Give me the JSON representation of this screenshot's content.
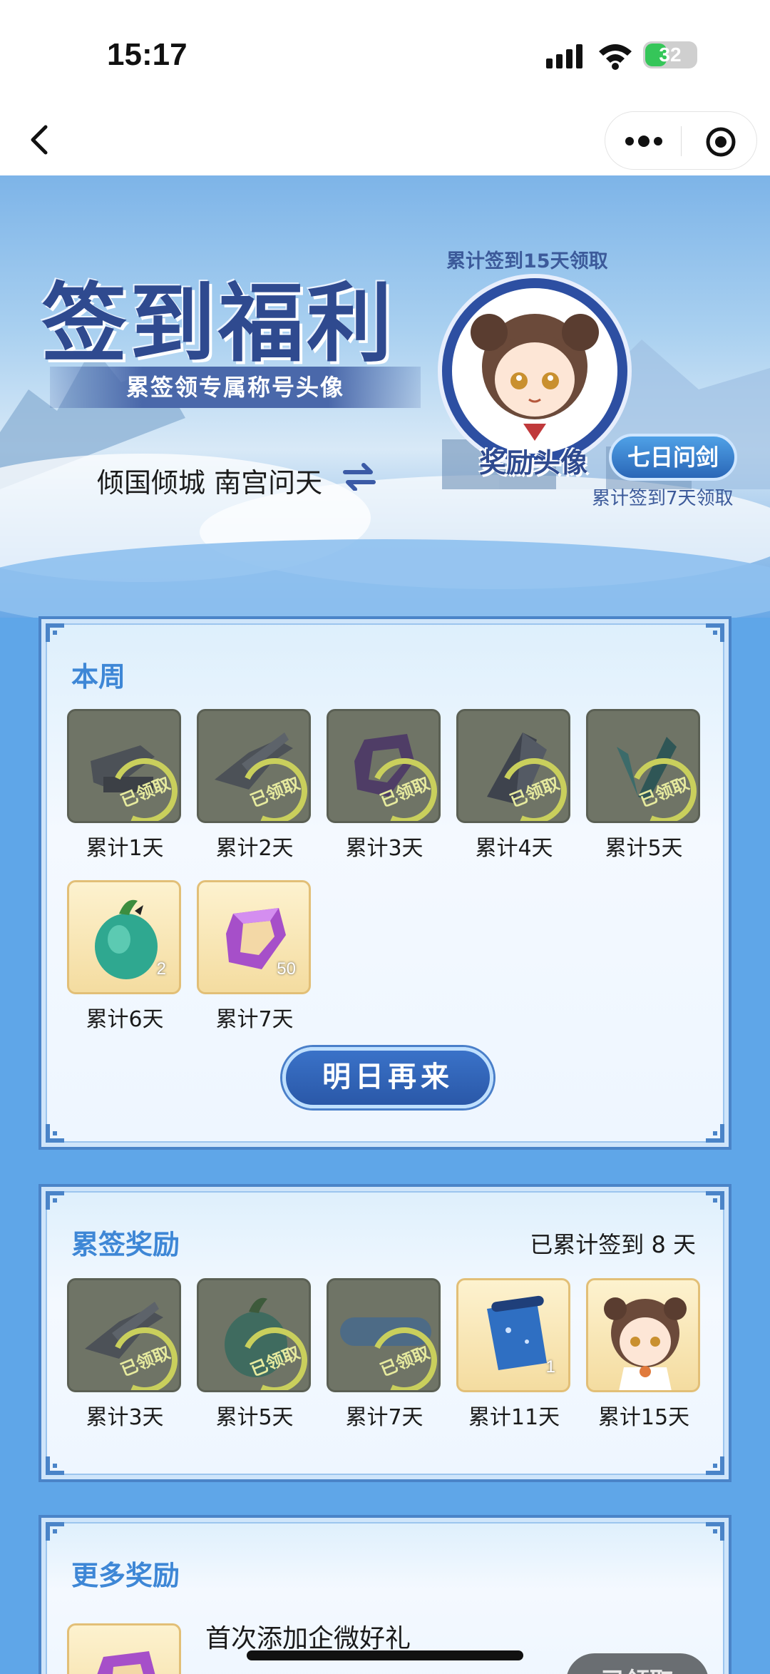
{
  "status_bar": {
    "time": "15:17",
    "battery": "32"
  },
  "banner": {
    "title": "签到福利",
    "subtitle": "累签领专属称号头像",
    "user_title": "倾国倾城 南宫问天",
    "avatar_caption": "累计签到15天领取",
    "avatar_label": "奖励头像",
    "title_badge": "七日问剑",
    "title_caption": "累计签到7天领取"
  },
  "this_week": {
    "heading": "本周",
    "items": [
      {
        "label": "累计1天",
        "claimed": true,
        "claimed_text": "已领取",
        "icon": "gray-anvil-icon"
      },
      {
        "label": "累计2天",
        "claimed": true,
        "claimed_text": "已领取",
        "icon": "gray-weapon-icon"
      },
      {
        "label": "累计3天",
        "claimed": true,
        "claimed_text": "已领取",
        "icon": "purple-gem-icon"
      },
      {
        "label": "累计4天",
        "claimed": true,
        "claimed_text": "已领取",
        "icon": "gray-crystal-icon"
      },
      {
        "label": "累计5天",
        "claimed": true,
        "claimed_text": "已领取",
        "icon": "green-leaf-icon"
      },
      {
        "label": "累计6天",
        "claimed": false,
        "qty": "2",
        "icon": "green-pouch-icon"
      },
      {
        "label": "累计7天",
        "claimed": false,
        "qty": "50",
        "icon": "purple-gem-icon"
      }
    ],
    "button": "明日再来"
  },
  "cumulative": {
    "heading": "累签奖励",
    "note": "已累计签到 8 天",
    "items": [
      {
        "label": "累计3天",
        "claimed": true,
        "claimed_text": "已领取",
        "icon": "gray-weapon-icon"
      },
      {
        "label": "累计5天",
        "claimed": true,
        "claimed_text": "已领取",
        "icon": "green-pouch-icon"
      },
      {
        "label": "累计7天",
        "claimed": true,
        "claimed_text": "已领取",
        "icon": "title-plate-icon"
      },
      {
        "label": "累计11天",
        "claimed": false,
        "qty": "1",
        "icon": "blue-scroll-icon"
      },
      {
        "label": "累计15天",
        "claimed": false,
        "icon": "avatar-girl-icon"
      }
    ]
  },
  "more": {
    "heading": "更多奖励",
    "row_title": "首次添加企微好礼",
    "button": "已领取"
  },
  "colors": {
    "accent": "#3e87d6",
    "panel_border": "#4a84c8",
    "button": "#2a58a8"
  }
}
